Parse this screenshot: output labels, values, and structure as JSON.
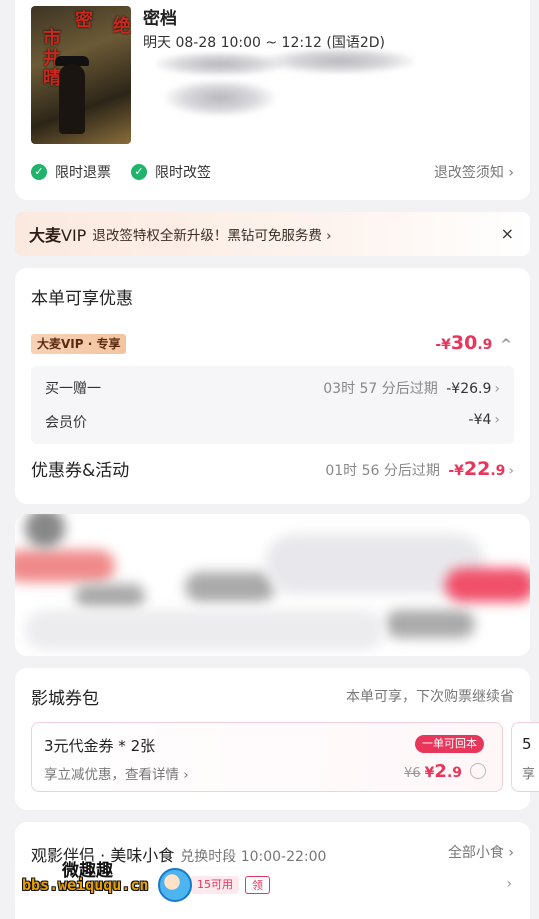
{
  "movie": {
    "title": "密档",
    "showtime": "明天 08-28 10:00 ~ 12:12 (国语2D)",
    "poster_text_left": "市井晴",
    "poster_text_top": "密",
    "poster_text_right": "绝",
    "guarantees": [
      "限时退票",
      "限时改签"
    ],
    "policy_link": "退改签须知 ›"
  },
  "vip_banner": {
    "logo_brand": "大麦",
    "logo_vip": "VIP",
    "text": "退改签特权全新升级！黑钻可免服务费 ›",
    "close": "×"
  },
  "discounts": {
    "title": "本单可享优惠",
    "vip_tag": "大麦VIP · 专享",
    "vip_amount_prefix": "-¥",
    "vip_amount_int": "30",
    "vip_amount_dec": ".9",
    "vip_chevron": "^",
    "items": [
      {
        "label": "买一赠一",
        "expire": "03时 57 分后过期",
        "amount": "-¥26.9"
      },
      {
        "label": "会员价",
        "expire": "",
        "amount": "-¥4"
      }
    ],
    "coupon": {
      "label": "优惠券&活动",
      "expire": "01时 56 分后过期",
      "amount_prefix": "-¥",
      "amount_int": "22",
      "amount_dec": ".9"
    }
  },
  "cinema_pack": {
    "title": "影城券包",
    "subtitle": "本单可享，下次购票继续省",
    "voucher": {
      "title": "3元代金券 * 2张",
      "desc": "享立减优惠，查看详情 ›",
      "badge": "一单可回本",
      "old_price": "¥6",
      "new_prefix": "¥",
      "new_int": "2",
      "new_dec": ".9"
    },
    "peek_title": "5",
    "peek_desc": "享"
  },
  "snacks": {
    "title": "观影伴侣 · 美味小食",
    "slot": "兑换时段 10:00-22:00",
    "all": "全部小食 ›",
    "chip_count": "15可用",
    "chip_action": "领",
    "arrow": "›"
  },
  "watermark": {
    "cn": "微趣趣",
    "url": "bbs.weiququ.cn"
  },
  "colors": {
    "accent": "#e8355a",
    "check": "#1fb36b",
    "vip_tag": "#f3c4a0"
  }
}
